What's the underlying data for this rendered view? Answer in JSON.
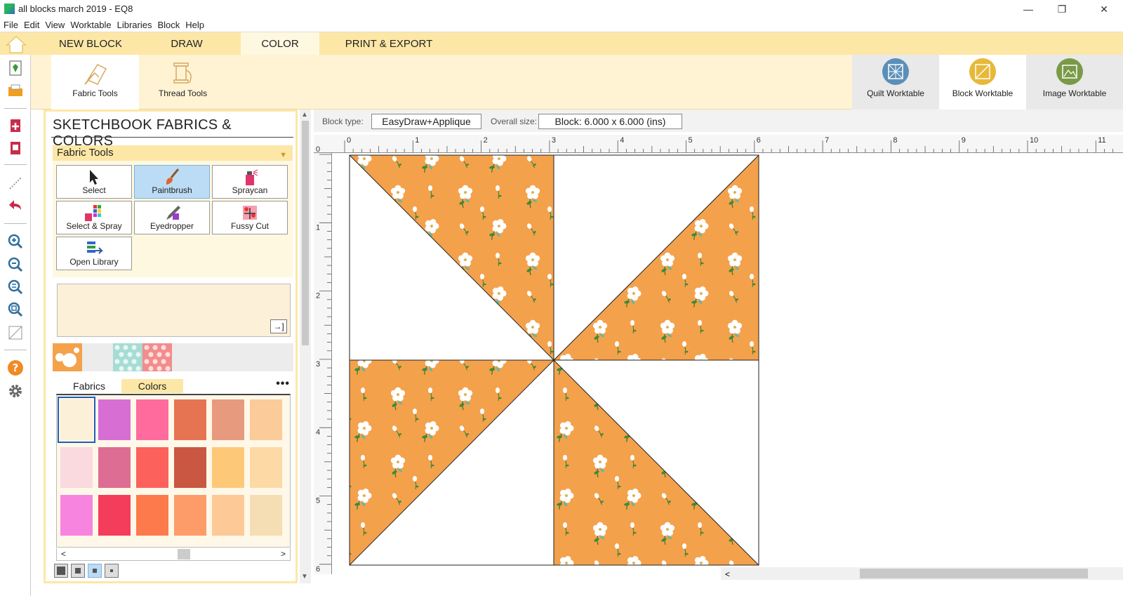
{
  "window": {
    "title": "all blocks march 2019 - EQ8",
    "min": "—",
    "max": "❐",
    "close": "✕"
  },
  "menu": [
    "File",
    "Edit",
    "View",
    "Worktable",
    "Libraries",
    "Block",
    "Help"
  ],
  "ribbon_tabs": [
    {
      "label": "NEW BLOCK",
      "active": false
    },
    {
      "label": "DRAW",
      "active": false
    },
    {
      "label": "COLOR",
      "active": true
    },
    {
      "label": "PRINT & EXPORT",
      "active": false
    }
  ],
  "ribbon_tools": {
    "fabric": "Fabric Tools",
    "thread": "Thread Tools"
  },
  "worktables": [
    {
      "label": "Quilt Worktable",
      "color": "#5b8fb8"
    },
    {
      "label": "Block Worktable",
      "color": "#e8b83a"
    },
    {
      "label": "Image Worktable",
      "color": "#7a9a48"
    }
  ],
  "panel": {
    "title": "SKETCHBOOK FABRICS & COLORS",
    "section": "Fabric Tools",
    "tools": [
      {
        "label": "Select",
        "icon": "select-arrow-icon",
        "selected": false
      },
      {
        "label": "Paintbrush",
        "icon": "paintbrush-icon",
        "selected": true
      },
      {
        "label": "Spraycan",
        "icon": "spraycan-icon",
        "selected": false
      },
      {
        "label": "Select & Spray",
        "icon": "select-spray-icon",
        "selected": false
      },
      {
        "label": "Eyedropper",
        "icon": "eyedropper-icon",
        "selected": false
      },
      {
        "label": "Fussy Cut",
        "icon": "fussy-cut-icon",
        "selected": false
      },
      {
        "label": "Open Library",
        "icon": "open-library-icon",
        "selected": false
      }
    ],
    "export_symbol": "→]",
    "tabs": [
      {
        "label": "Fabrics",
        "active": false
      },
      {
        "label": "Colors",
        "active": true
      }
    ],
    "more": "•••",
    "colors": [
      [
        "#fdf0d8",
        "#d76ed4",
        "#fe6b9c",
        "#e67452",
        "#e89a7e",
        "#fbcb9a"
      ],
      [
        "#fad9df",
        "#dd6d92",
        "#fc625b",
        "#c95742",
        "#fdc978",
        "#fdd9a6"
      ],
      [
        "#f784df",
        "#f43d5b",
        "#fd7a4c",
        "#fd9c69",
        "#fdc996",
        "#f5deb3"
      ]
    ],
    "scroll_left": "<",
    "scroll_right": ">"
  },
  "info": {
    "block_type_label": "Block type:",
    "block_type": "EasyDraw+Applique",
    "overall_label": "Overall size:",
    "overall": "Block: 6.000 x 6.000 (ins)"
  },
  "ruler": {
    "top": [
      "0",
      "1",
      "2",
      "3",
      "4",
      "5",
      "6",
      "7",
      "8",
      "9",
      "10",
      "11"
    ],
    "left": [
      "0",
      "1",
      "2",
      "3",
      "4",
      "5",
      "6"
    ]
  },
  "fabric_colors": {
    "orange": "#f4a14c",
    "white": "#ffffff"
  }
}
